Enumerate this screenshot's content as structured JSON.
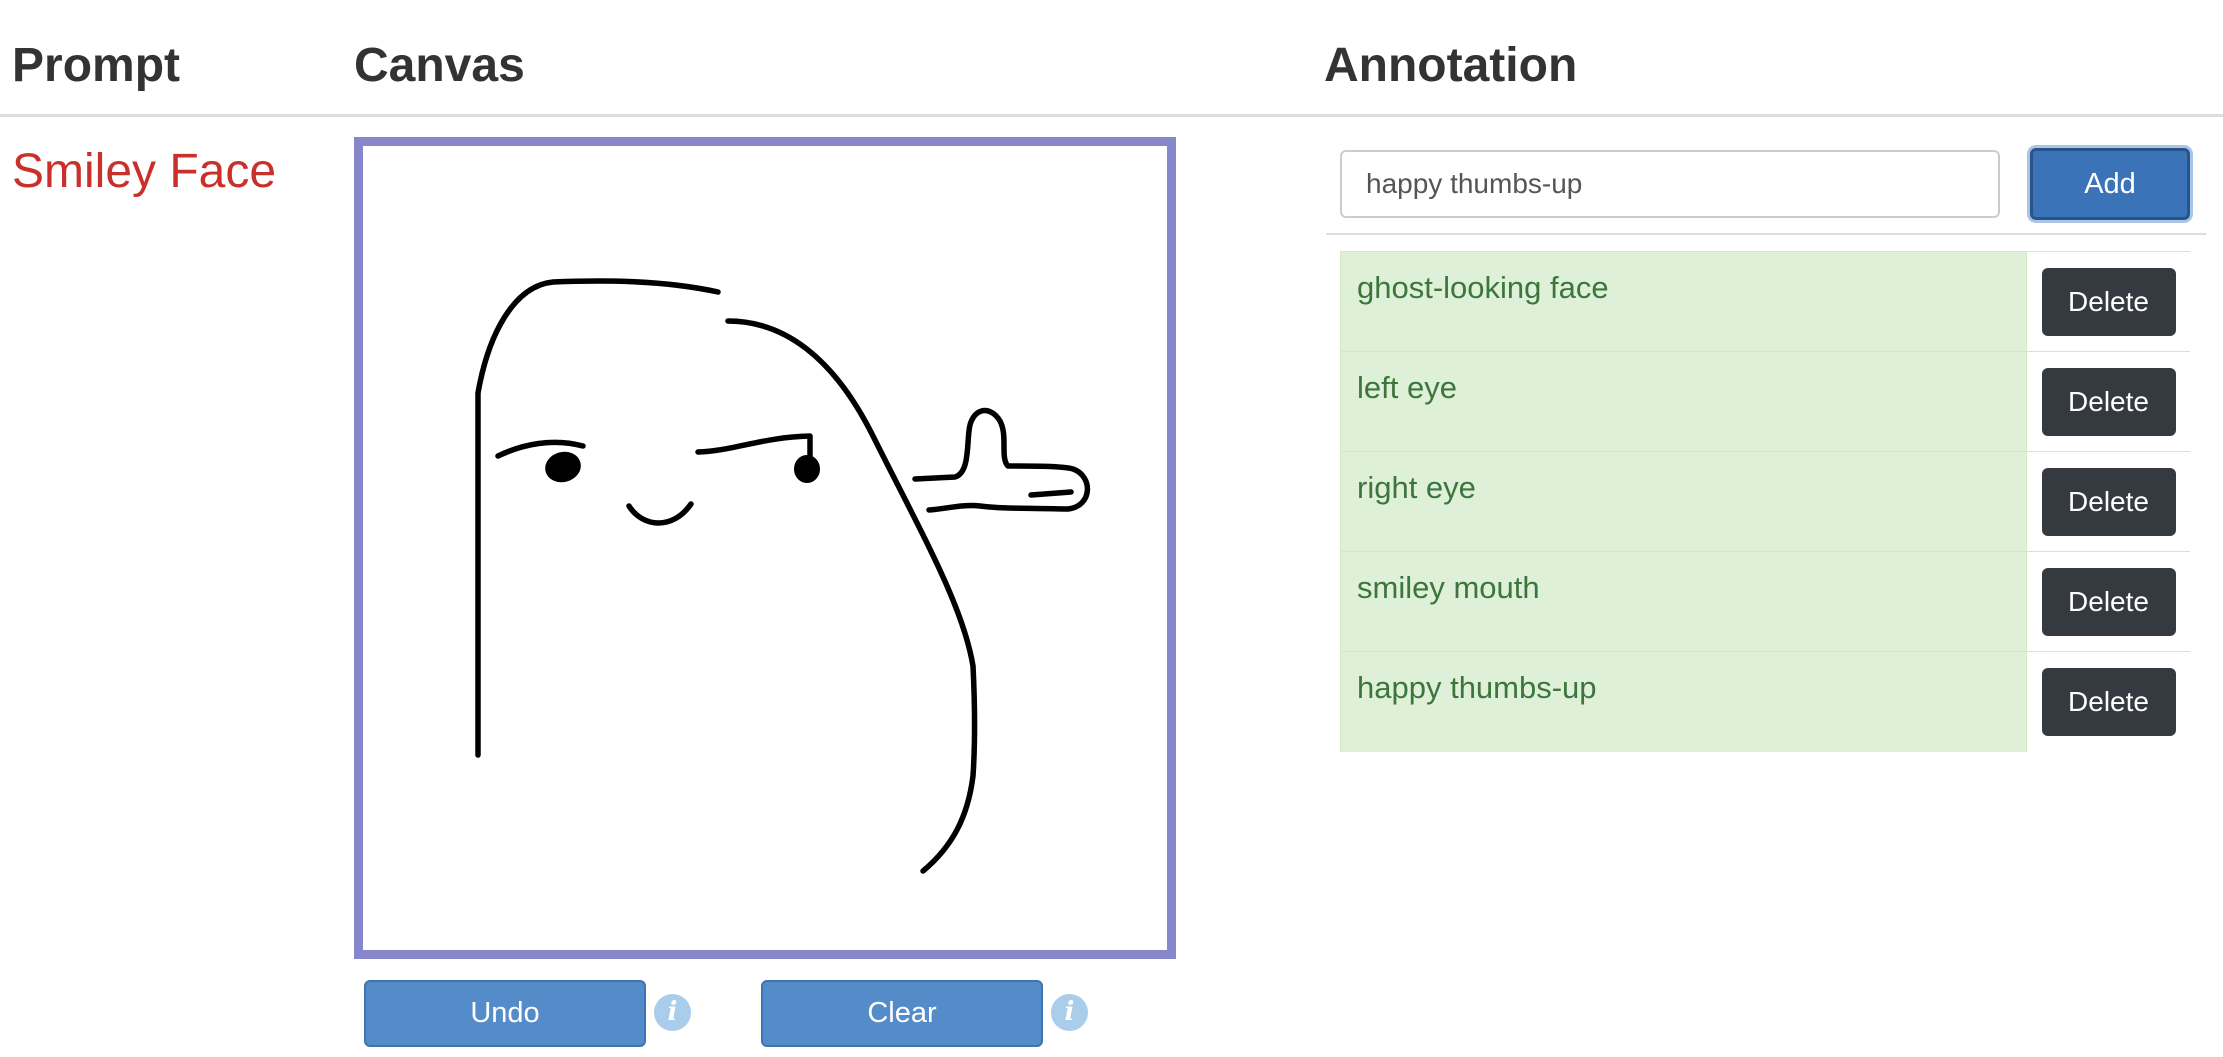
{
  "headers": {
    "prompt": "Prompt",
    "canvas": "Canvas",
    "annotation": "Annotation"
  },
  "prompt": {
    "text": "Smiley Face",
    "color": "#c9302c"
  },
  "canvas": {
    "border_color": "#8686cc",
    "stroke_color": "#000000",
    "undo_label": "Undo",
    "clear_label": "Clear",
    "info_glyph": "i"
  },
  "annotation": {
    "input_value": "happy thumbs-up",
    "add_label": "Add",
    "delete_label": "Delete",
    "items": [
      "ghost-looking face",
      "left eye",
      "right eye",
      "smiley mouth",
      "happy thumbs-up"
    ]
  },
  "colors": {
    "accent_blue": "#548bc9",
    "add_blue": "#3a73b7",
    "annotation_bg": "#dff0d8",
    "annotation_text": "#3c763d",
    "delete_dark": "#343a40"
  }
}
